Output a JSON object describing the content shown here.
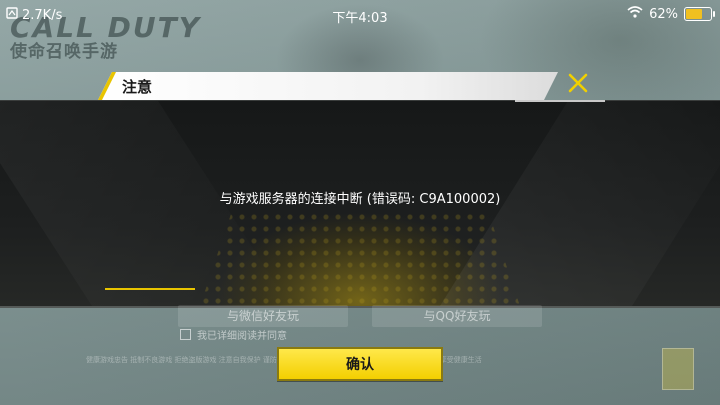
{
  "status_bar": {
    "speed": "2.7K/s",
    "time": "下午4:03",
    "battery": "62%"
  },
  "background": {
    "logo_line1": "CALL DUTY",
    "logo_line2": "使命召唤手游"
  },
  "dialog": {
    "title": "注意",
    "message": "与游戏服务器的连接中断 (错误码: C9A100002)",
    "confirm_label": "确认"
  },
  "behind": {
    "left_button": "与微信好友玩",
    "right_button": "与QQ好友玩",
    "checkbox_label": "我已详细阅读并同意",
    "fine_print": "健康游戏忠告 抵制不良游戏 拒绝盗版游戏 注意自我保护 谨防受骗上当 适度游戏益脑 沉迷游戏伤身 合理安排时间 享受健康生活"
  },
  "colors": {
    "accent": "#f3cf00",
    "dialog_bg": "#1d1f1f"
  },
  "icons": {
    "close": "close-icon",
    "wifi": "wifi-icon",
    "battery": "battery-icon",
    "data": "data-icon"
  },
  "battery_level": 0.62
}
